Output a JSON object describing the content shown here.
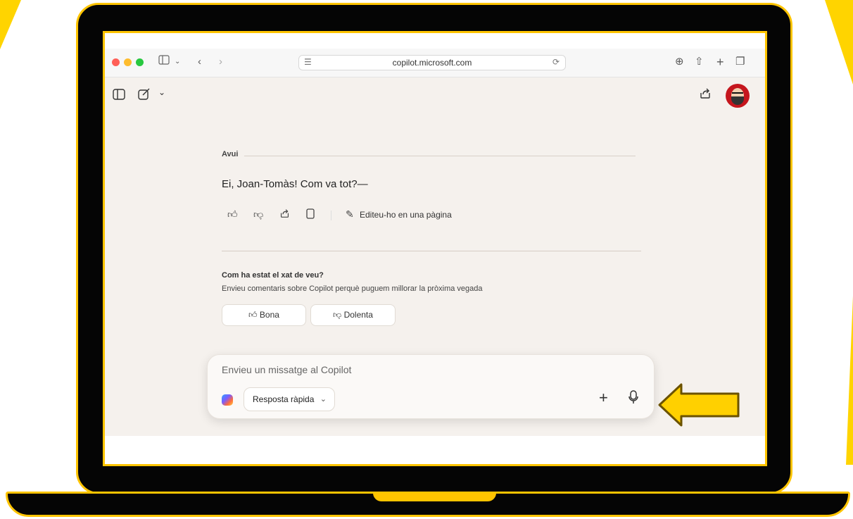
{
  "browser": {
    "url": "copilot.microsoft.com",
    "toolbar_icons": [
      "sidebar-icon",
      "chevron-down-icon",
      "back-icon",
      "forward-icon",
      "translate-icon",
      "reload-icon",
      "download-icon",
      "share-icon",
      "new-tab-icon",
      "tabs-overview-icon"
    ]
  },
  "copilot": {
    "header_icons": [
      "sidebar-toggle-icon",
      "new-chat-icon",
      "chevron-down-icon",
      "share-icon",
      "avatar"
    ],
    "today_label": "Avui",
    "greeting": "Ei, Joan-Tomàs! Com va tot?—",
    "actions": {
      "edit_label": "Editeu-ho en una pàgina"
    },
    "feedback": {
      "title": "Com ha estat el xat de veu?",
      "subtitle": "Envieu comentaris sobre Copilot perquè puguem millorar la pròxima vegada",
      "good_label": "Bona",
      "bad_label": "Dolenta"
    },
    "composer": {
      "placeholder": "Envieu un missatge al Copilot",
      "mode": "Resposta ràpida"
    }
  },
  "colors": {
    "frame_accent": "#ffc400",
    "page_background": "#f5f1ed",
    "arrow_fill": "#ffd000"
  }
}
